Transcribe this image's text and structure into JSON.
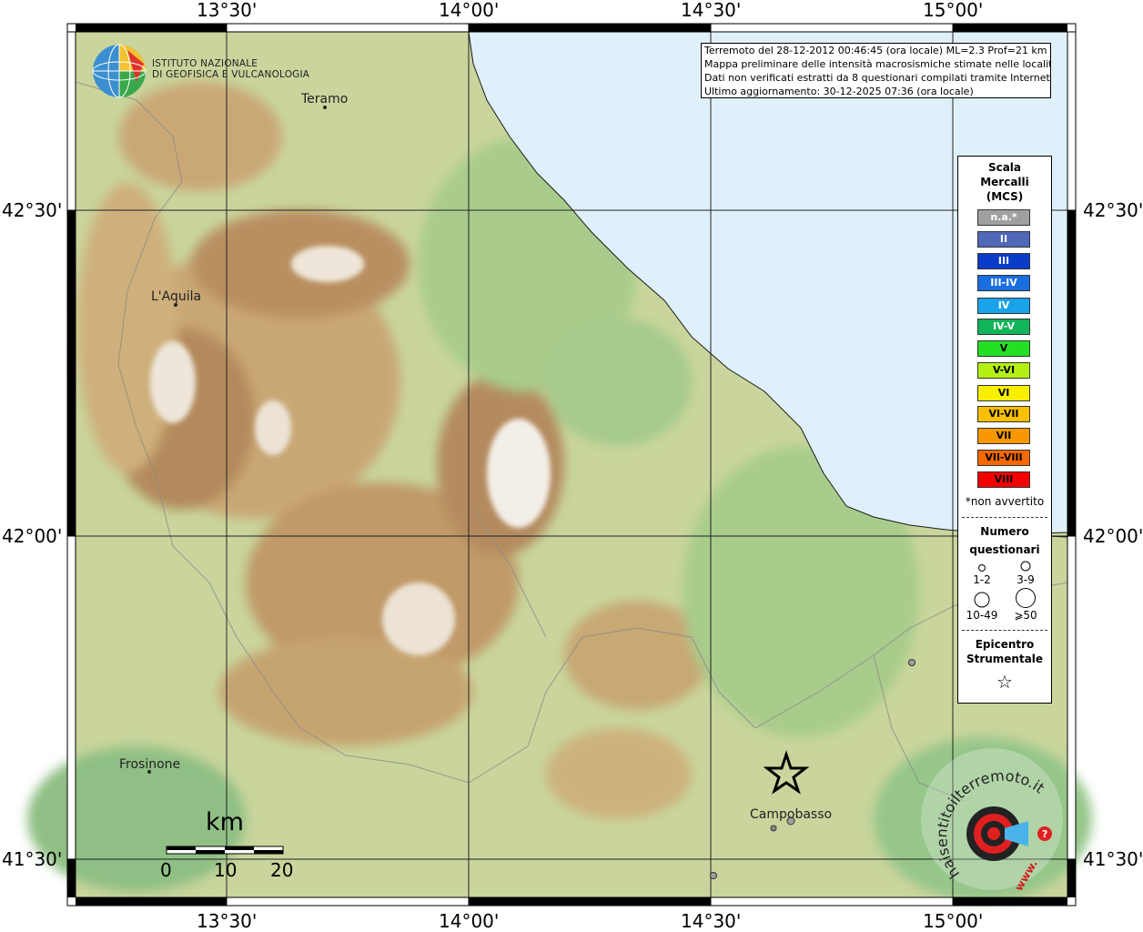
{
  "map": {
    "lon_labels": [
      "13°30'",
      "14°00'",
      "14°30'",
      "15°00'"
    ],
    "lat_labels": [
      "42°30'",
      "42°00'",
      "41°30'"
    ],
    "cities": [
      {
        "name": "Teramo"
      },
      {
        "name": "L'Aquila"
      },
      {
        "name": "Frosinone"
      },
      {
        "name": "Campobasso"
      }
    ]
  },
  "logo": {
    "line1": "ISTITUTO NAZIONALE",
    "line2": "DI GEOFISICA E VULCANOLOGIA"
  },
  "info": {
    "line1": "Terremoto del 28-12-2012 00:46:45 (ora locale) ML=2.3 Prof=21 km",
    "line2": "Mappa preliminare delle intensità macrosismiche stimate nelle località",
    "line3": "Dati non verificati estratti da 8 questionari compilati tramite Internet.",
    "line4": "Ultimo aggiornamento: 30-12-2025 07:36 (ora locale)"
  },
  "legend": {
    "title_line1": "Scala",
    "title_line2": "Mercalli",
    "title_line3": "(MCS)",
    "scale": [
      {
        "label": "n.a.*",
        "color": "#a0a0a0"
      },
      {
        "label": "II",
        "color": "#5068b8"
      },
      {
        "label": "III",
        "color": "#0a3cc8"
      },
      {
        "label": "III-IV",
        "color": "#1a6ee0"
      },
      {
        "label": "IV",
        "color": "#1aa2ea"
      },
      {
        "label": "IV-V",
        "color": "#12b45a"
      },
      {
        "label": "V",
        "color": "#24e024"
      },
      {
        "label": "V-VI",
        "color": "#b4f014"
      },
      {
        "label": "VI",
        "color": "#f8f000"
      },
      {
        "label": "VI-VII",
        "color": "#f8c000"
      },
      {
        "label": "VII",
        "color": "#f89800"
      },
      {
        "label": "VII-VIII",
        "color": "#f86800"
      },
      {
        "label": "VIII",
        "color": "#f40000"
      }
    ],
    "note": "*non avvertito",
    "count_title_line1": "Numero",
    "count_title_line2": "questionari",
    "counts": [
      "1-2",
      "3-9",
      "10-49",
      "⩾50"
    ],
    "epicenter_line1": "Epicentro",
    "epicenter_line2": "Strumentale",
    "epicenter_symbol": "☆"
  },
  "scale_bar": {
    "unit": "km",
    "ticks": [
      "0",
      "10",
      "20"
    ]
  },
  "watermark": {
    "text": "haisentitoilterremoto.it",
    "url": "www."
  }
}
